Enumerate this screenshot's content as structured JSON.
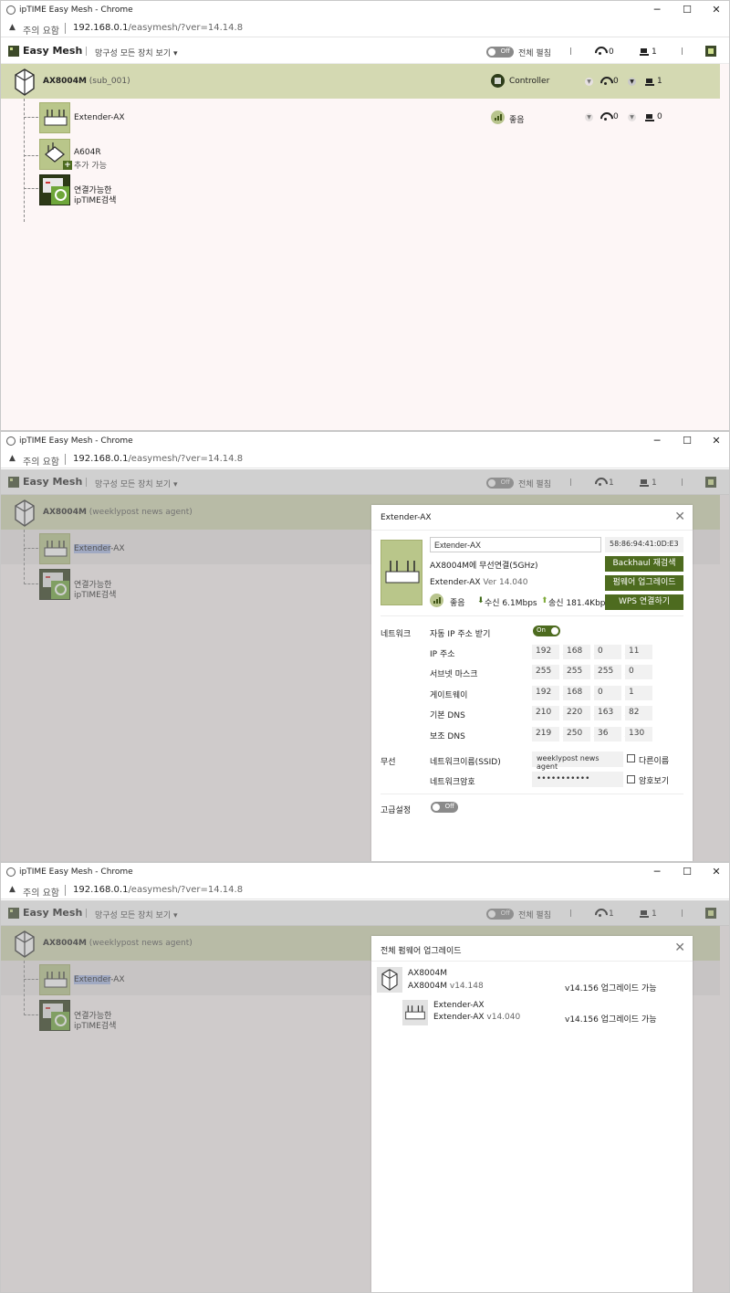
{
  "browser": {
    "title": "ipTIME Easy Mesh - Chrome",
    "security_note": "주의 요함",
    "url_host": "192.168.0.1",
    "url_path": "/easymesh/?ver=14.14.8"
  },
  "header": {
    "brand": "Easy Mesh",
    "show_all": "망구성 모든 장치 보기 ▾",
    "expand_label": "전체 펼침",
    "toggle_off": "Off",
    "toggle_on": "On"
  },
  "screens": [
    {
      "wifi_count": "0",
      "lan_count": "1",
      "root": {
        "name": "AX8004M",
        "sub": "(sub_001)",
        "role": "Controller",
        "wifi": "0",
        "lan": "1"
      },
      "extender": {
        "name": "Extender-AX",
        "signal": "좋음",
        "wifi": "0",
        "lan": "0"
      },
      "a604": {
        "name": "A604R",
        "note": "추가 가능"
      },
      "search": {
        "line1": "연결가능한",
        "line2": "ipTIME검색"
      }
    },
    {
      "wifi_count": "1",
      "lan_count": "1",
      "root": {
        "name": "AX8004M",
        "sub": "(weeklypost news agent)"
      },
      "extender": {
        "name_hl": "Extender",
        "name_rest": "-AX"
      },
      "search": {
        "line1": "연결가능한",
        "line2": "ipTIME검색"
      }
    },
    {
      "wifi_count": "1",
      "lan_count": "1",
      "root": {
        "name": "AX8004M",
        "sub": "(weeklypost news agent)"
      },
      "extender": {
        "name_hl": "Extender",
        "name_rest": "-AX"
      },
      "search": {
        "line1": "연결가능한",
        "line2": "ipTIME검색"
      }
    }
  ],
  "detail_modal": {
    "title": "Extender-AX",
    "name_value": "Extender-AX",
    "mac": "58:86:94:41:0D:E3",
    "conn": "AX8004M에 무선연결(5GHz)",
    "model": "Extender-AX",
    "ver": "Ver 14.040",
    "signal": "좋음",
    "rx": "수신 6.1Mbps",
    "tx": "송신 181.4Kbps",
    "btn_backhaul": "Backhaul 재검색",
    "btn_firmware": "펌웨어 업그레이드",
    "btn_wps": "WPS 연결하기",
    "network_section": "네트워크",
    "auto_ip": "자동 IP 주소 받기",
    "rows": [
      {
        "label": "IP 주소",
        "octets": [
          "192",
          "168",
          "0",
          "11"
        ]
      },
      {
        "label": "서브넷 마스크",
        "octets": [
          "255",
          "255",
          "255",
          "0"
        ]
      },
      {
        "label": "게이트웨이",
        "octets": [
          "192",
          "168",
          "0",
          "1"
        ]
      },
      {
        "label": "기본 DNS",
        "octets": [
          "210",
          "220",
          "163",
          "82"
        ]
      },
      {
        "label": "보조 DNS",
        "octets": [
          "219",
          "250",
          "36",
          "130"
        ]
      }
    ],
    "wireless_section": "무선",
    "ssid_label": "네트워크이름(SSID)",
    "ssid_value": "weeklypost news agent",
    "other_name": "다른이름",
    "pw_label": "네트워크암호",
    "pw_value": "•••••••••••",
    "show_pw": "암호보기",
    "advanced": "고급설정"
  },
  "fw_modal": {
    "title": "전체 펌웨어 업그레이드",
    "items": [
      {
        "name": "AX8004M",
        "model": "AX8004M",
        "ver": "v14.148",
        "status": "v14.156 업그레이드 가능"
      },
      {
        "name": "Extender-AX",
        "model": "Extender-AX",
        "ver": "v14.040",
        "status": "v14.156 업그레이드 가능"
      }
    ]
  },
  "colors": {
    "accent": "#4d6b1f",
    "root_row": "#d4d9b2",
    "tile": "#b9c68a"
  },
  "icons": [
    "chrome-icon",
    "warning-icon",
    "easymesh-logo-icon",
    "wifi-icon",
    "lan-icon",
    "chart-icon",
    "router-icon",
    "extender-icon",
    "controller-icon",
    "signal-icon",
    "plus-icon",
    "search-device-icon",
    "close-icon"
  ]
}
